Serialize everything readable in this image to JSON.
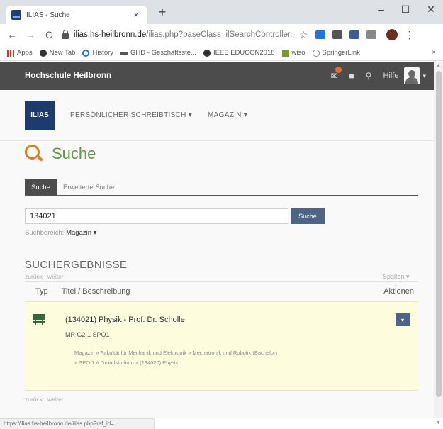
{
  "browser": {
    "tab_title": "ILIAS - Suche",
    "tab_close": "×",
    "new_tab": "+",
    "window": {
      "minimize": "–",
      "maximize": "☐",
      "close": "✕"
    },
    "back": "←",
    "forward": "→",
    "reload": "C",
    "url_domain": "ilias.hs-heilbronn.de",
    "url_path": "/ilias.php?baseClass=ilSearchController...",
    "star": "☆",
    "kebab": "⋮",
    "bookmarks": [
      {
        "label": "Apps",
        "color": "#d93025"
      },
      {
        "label": "New Tab",
        "color": "#333333"
      },
      {
        "label": "History",
        "color": "#1a73e8"
      },
      {
        "label": "GHD - Geschäftsste...",
        "color": "#555555"
      },
      {
        "label": "IEEE EDUCON2018",
        "color": "#333333"
      },
      {
        "label": "wiso",
        "color": "#7a9a2a"
      },
      {
        "label": "SpringerLink",
        "color": "#888888"
      }
    ],
    "bookmarks_more": "»",
    "status_url": "https://ilias.hs-heilbronn.de/ilias.php?ref_id=..."
  },
  "topbar": {
    "brand": "Hochschule Heilbronn",
    "icons": [
      "mail-icon",
      "chat-icon",
      "search-icon"
    ],
    "help": "Hilfe",
    "caret": "▾"
  },
  "mainnav": {
    "logo": "ILIAS",
    "items": [
      "PERSÖNLICHER SCHREIBTISCH ▾",
      "MAGAZIN ▾"
    ]
  },
  "page": {
    "title": "Suche",
    "tabs": [
      "Suche",
      "Erweiterte Suche"
    ],
    "search_value": "134021",
    "search_button": "Suche",
    "scope_label": "Suchbereich:",
    "scope_value": "Magazin ▾"
  },
  "results": {
    "title": "SUCHERGEBNISSE",
    "pager": "zurück | weiter",
    "columns": "Spalten ▾",
    "headers": {
      "type": "Typ",
      "title": "Titel / Beschreibung",
      "actions": "Aktionen"
    },
    "rows": [
      {
        "title": "(134021) Physik - Prof. Dr. Scholle",
        "description": "MR G2.1 SPO1",
        "path_line1": "Magazin » Fakultät für Mechanik und Elektronik » Mechatronik und Robotik (Bachelor)",
        "path_line2": "» SPO 1 » Grundstudium » (134020) Physik",
        "action": "▾"
      }
    ]
  }
}
